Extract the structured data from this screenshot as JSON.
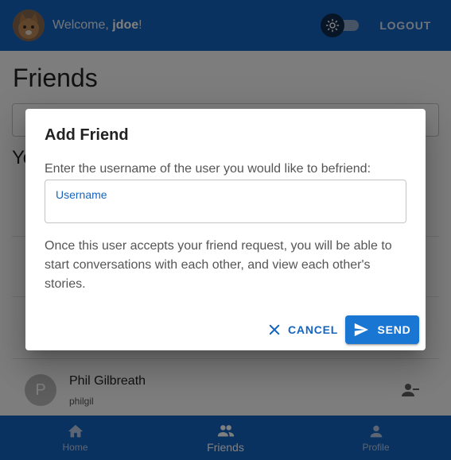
{
  "header": {
    "welcome_prefix": "Welcome, ",
    "username": "jdoe",
    "welcome_suffix": "!",
    "logout_label": "LOGOUT",
    "theme_icon": "sun-icon"
  },
  "page": {
    "title": "Friends",
    "section_title": "Yo"
  },
  "friends": [
    {
      "initial": "P",
      "name": "Phil Gilbreath",
      "username": "philgil"
    }
  ],
  "dialog": {
    "title": "Add Friend",
    "prompt": "Enter the username of the user you would like to befriend:",
    "username_label": "Username",
    "username_value": "",
    "info": "Once this user accepts your friend request, you will be able to start conversations with each other, and view each other's stories.",
    "cancel_label": "CANCEL",
    "send_label": "SEND"
  },
  "bottom_nav": [
    {
      "label": "Home",
      "icon": "home-icon",
      "active": false
    },
    {
      "label": "Friends",
      "icon": "people-icon",
      "active": true
    },
    {
      "label": "Profile",
      "icon": "person-icon",
      "active": false
    }
  ],
  "colors": {
    "primary": "#1565c0",
    "button": "#1976d2"
  }
}
